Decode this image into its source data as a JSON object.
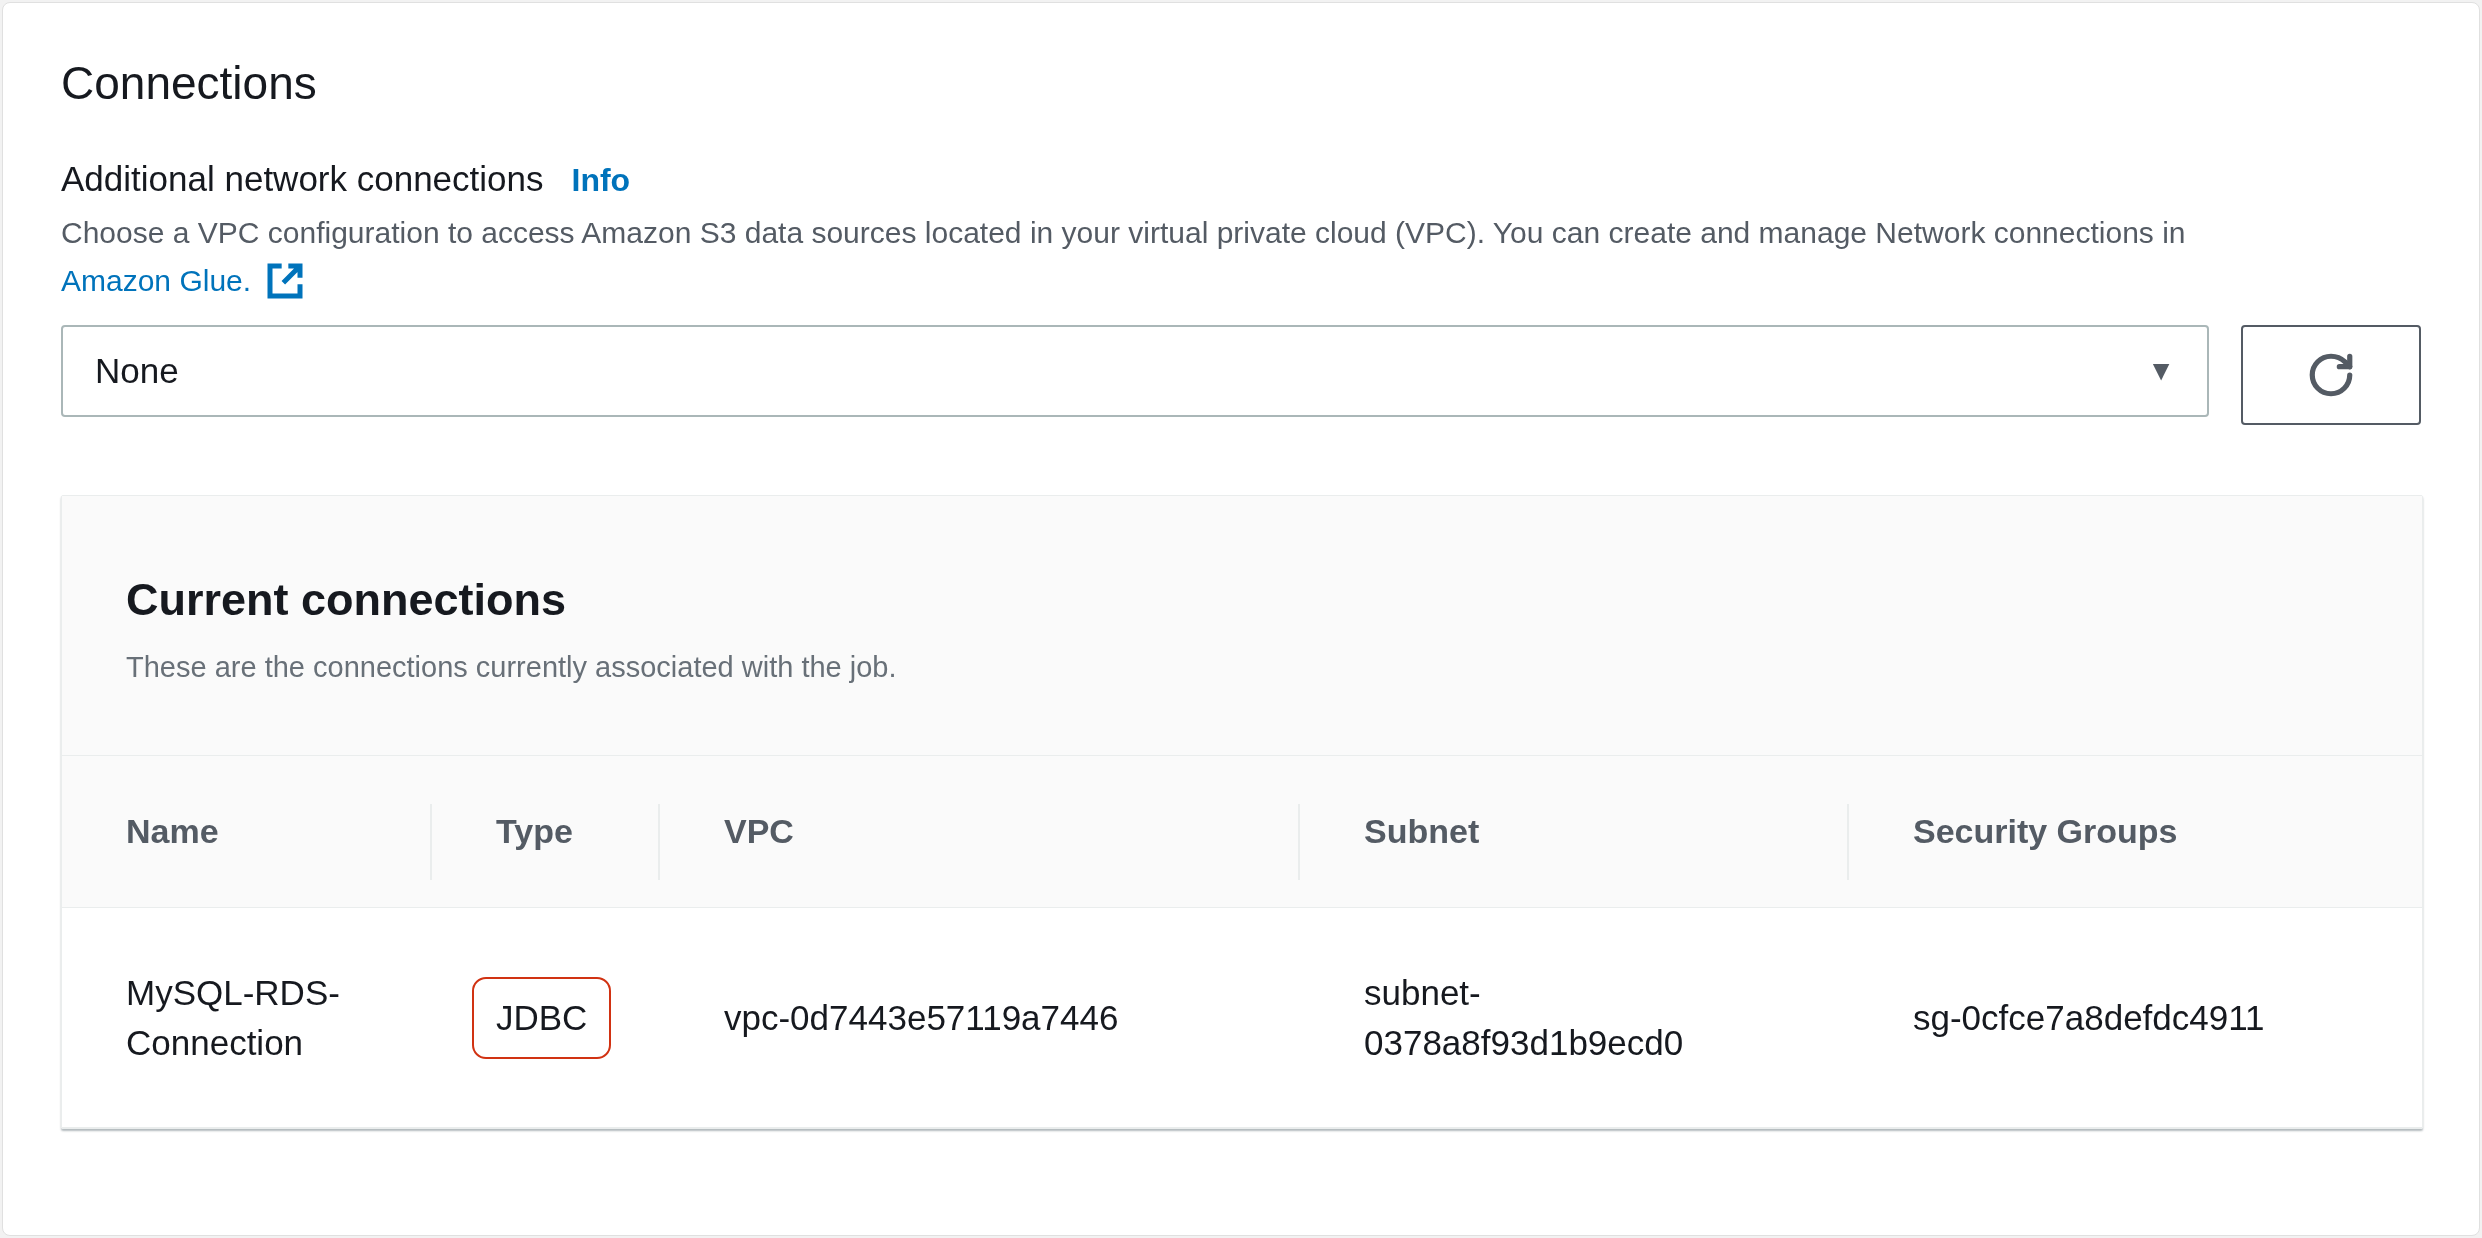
{
  "section": {
    "title": "Connections"
  },
  "field": {
    "label": "Additional network connections",
    "info_link": "Info",
    "description": "Choose a VPC configuration to access Amazon S3 data sources located in your virtual private cloud (VPC). You can create and manage Network connections in",
    "description_link": "Amazon Glue.",
    "select_value": "None",
    "select_caret": "▼"
  },
  "panel": {
    "title": "Current connections",
    "description": "These are the connections currently associated with the job.",
    "columns": [
      "Name",
      "Type",
      "VPC",
      "Subnet",
      "Security Groups"
    ],
    "rows": [
      {
        "cells": [
          {
            "text": "MySQL-RDS-Connection",
            "highlighted": false
          },
          {
            "text": "JDBC",
            "highlighted": true
          },
          {
            "text": "vpc-0d7443e57119a7446",
            "highlighted": false
          },
          {
            "text": "subnet-0378a8f93d1b9ecd0",
            "highlighted": false
          },
          {
            "text": "sg-0cfce7a8defdc4911",
            "highlighted": false
          }
        ]
      }
    ]
  }
}
